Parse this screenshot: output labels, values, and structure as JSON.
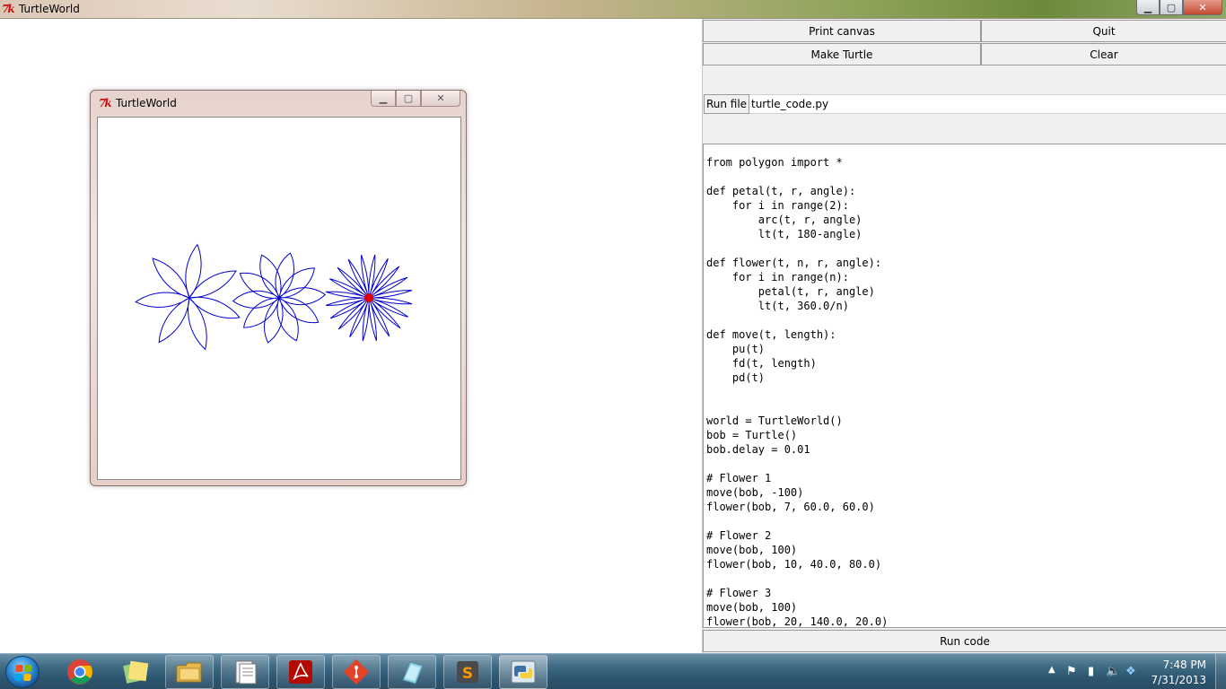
{
  "window": {
    "title": "TurtleWorld",
    "logo_text": "7k",
    "controls": {
      "minimize": "▁",
      "maximize": "▢",
      "close": "✕"
    }
  },
  "nested_window": {
    "title": "TurtleWorld",
    "logo_text": "7k",
    "controls": {
      "minimize": "▁",
      "maximize": "▢",
      "close": "✕"
    }
  },
  "turtle_drawing": {
    "stroke_color": "#0000cc",
    "turtle_color": "#e00000",
    "flowers": [
      {
        "n": 7,
        "r": 60.0,
        "angle": 60.0
      },
      {
        "n": 10,
        "r": 40.0,
        "angle": 80.0
      },
      {
        "n": 20,
        "r": 140.0,
        "angle": 20.0
      }
    ]
  },
  "controls": {
    "print_canvas": "Print canvas",
    "quit": "Quit",
    "make_turtle": "Make Turtle",
    "clear": "Clear",
    "run_file": "Run file",
    "file_name": "turtle_code.py",
    "run_code": "Run code"
  },
  "code_lines": [
    "from polygon import *",
    "",
    "def petal(t, r, angle):",
    "    for i in range(2):",
    "        arc(t, r, angle)",
    "        lt(t, 180-angle)",
    "",
    "def flower(t, n, r, angle):",
    "    for i in range(n):",
    "        petal(t, r, angle)",
    "        lt(t, 360.0/n)",
    "",
    "def move(t, length):",
    "    pu(t)",
    "    fd(t, length)",
    "    pd(t)",
    "",
    "",
    "world = TurtleWorld()",
    "bob = Turtle()",
    "bob.delay = 0.01",
    "",
    "# Flower 1",
    "move(bob, -100)",
    "flower(bob, 7, 60.0, 60.0)",
    "",
    "# Flower 2",
    "move(bob, 100)",
    "flower(bob, 10, 40.0, 80.0)",
    "",
    "# Flower 3",
    "move(bob, 100)",
    "flower(bob, 20, 140.0, 20.0)"
  ],
  "taskbar": {
    "apps": [
      "start-icon",
      "chrome-icon",
      "sticky-notes-icon",
      "file-explorer-icon",
      "documents-icon",
      "acrobat-icon",
      "git-icon",
      "paint-icon",
      "sublime-text-icon",
      "python-icon"
    ],
    "clock_time": "7:48 PM",
    "clock_date": "7/31/2013"
  }
}
